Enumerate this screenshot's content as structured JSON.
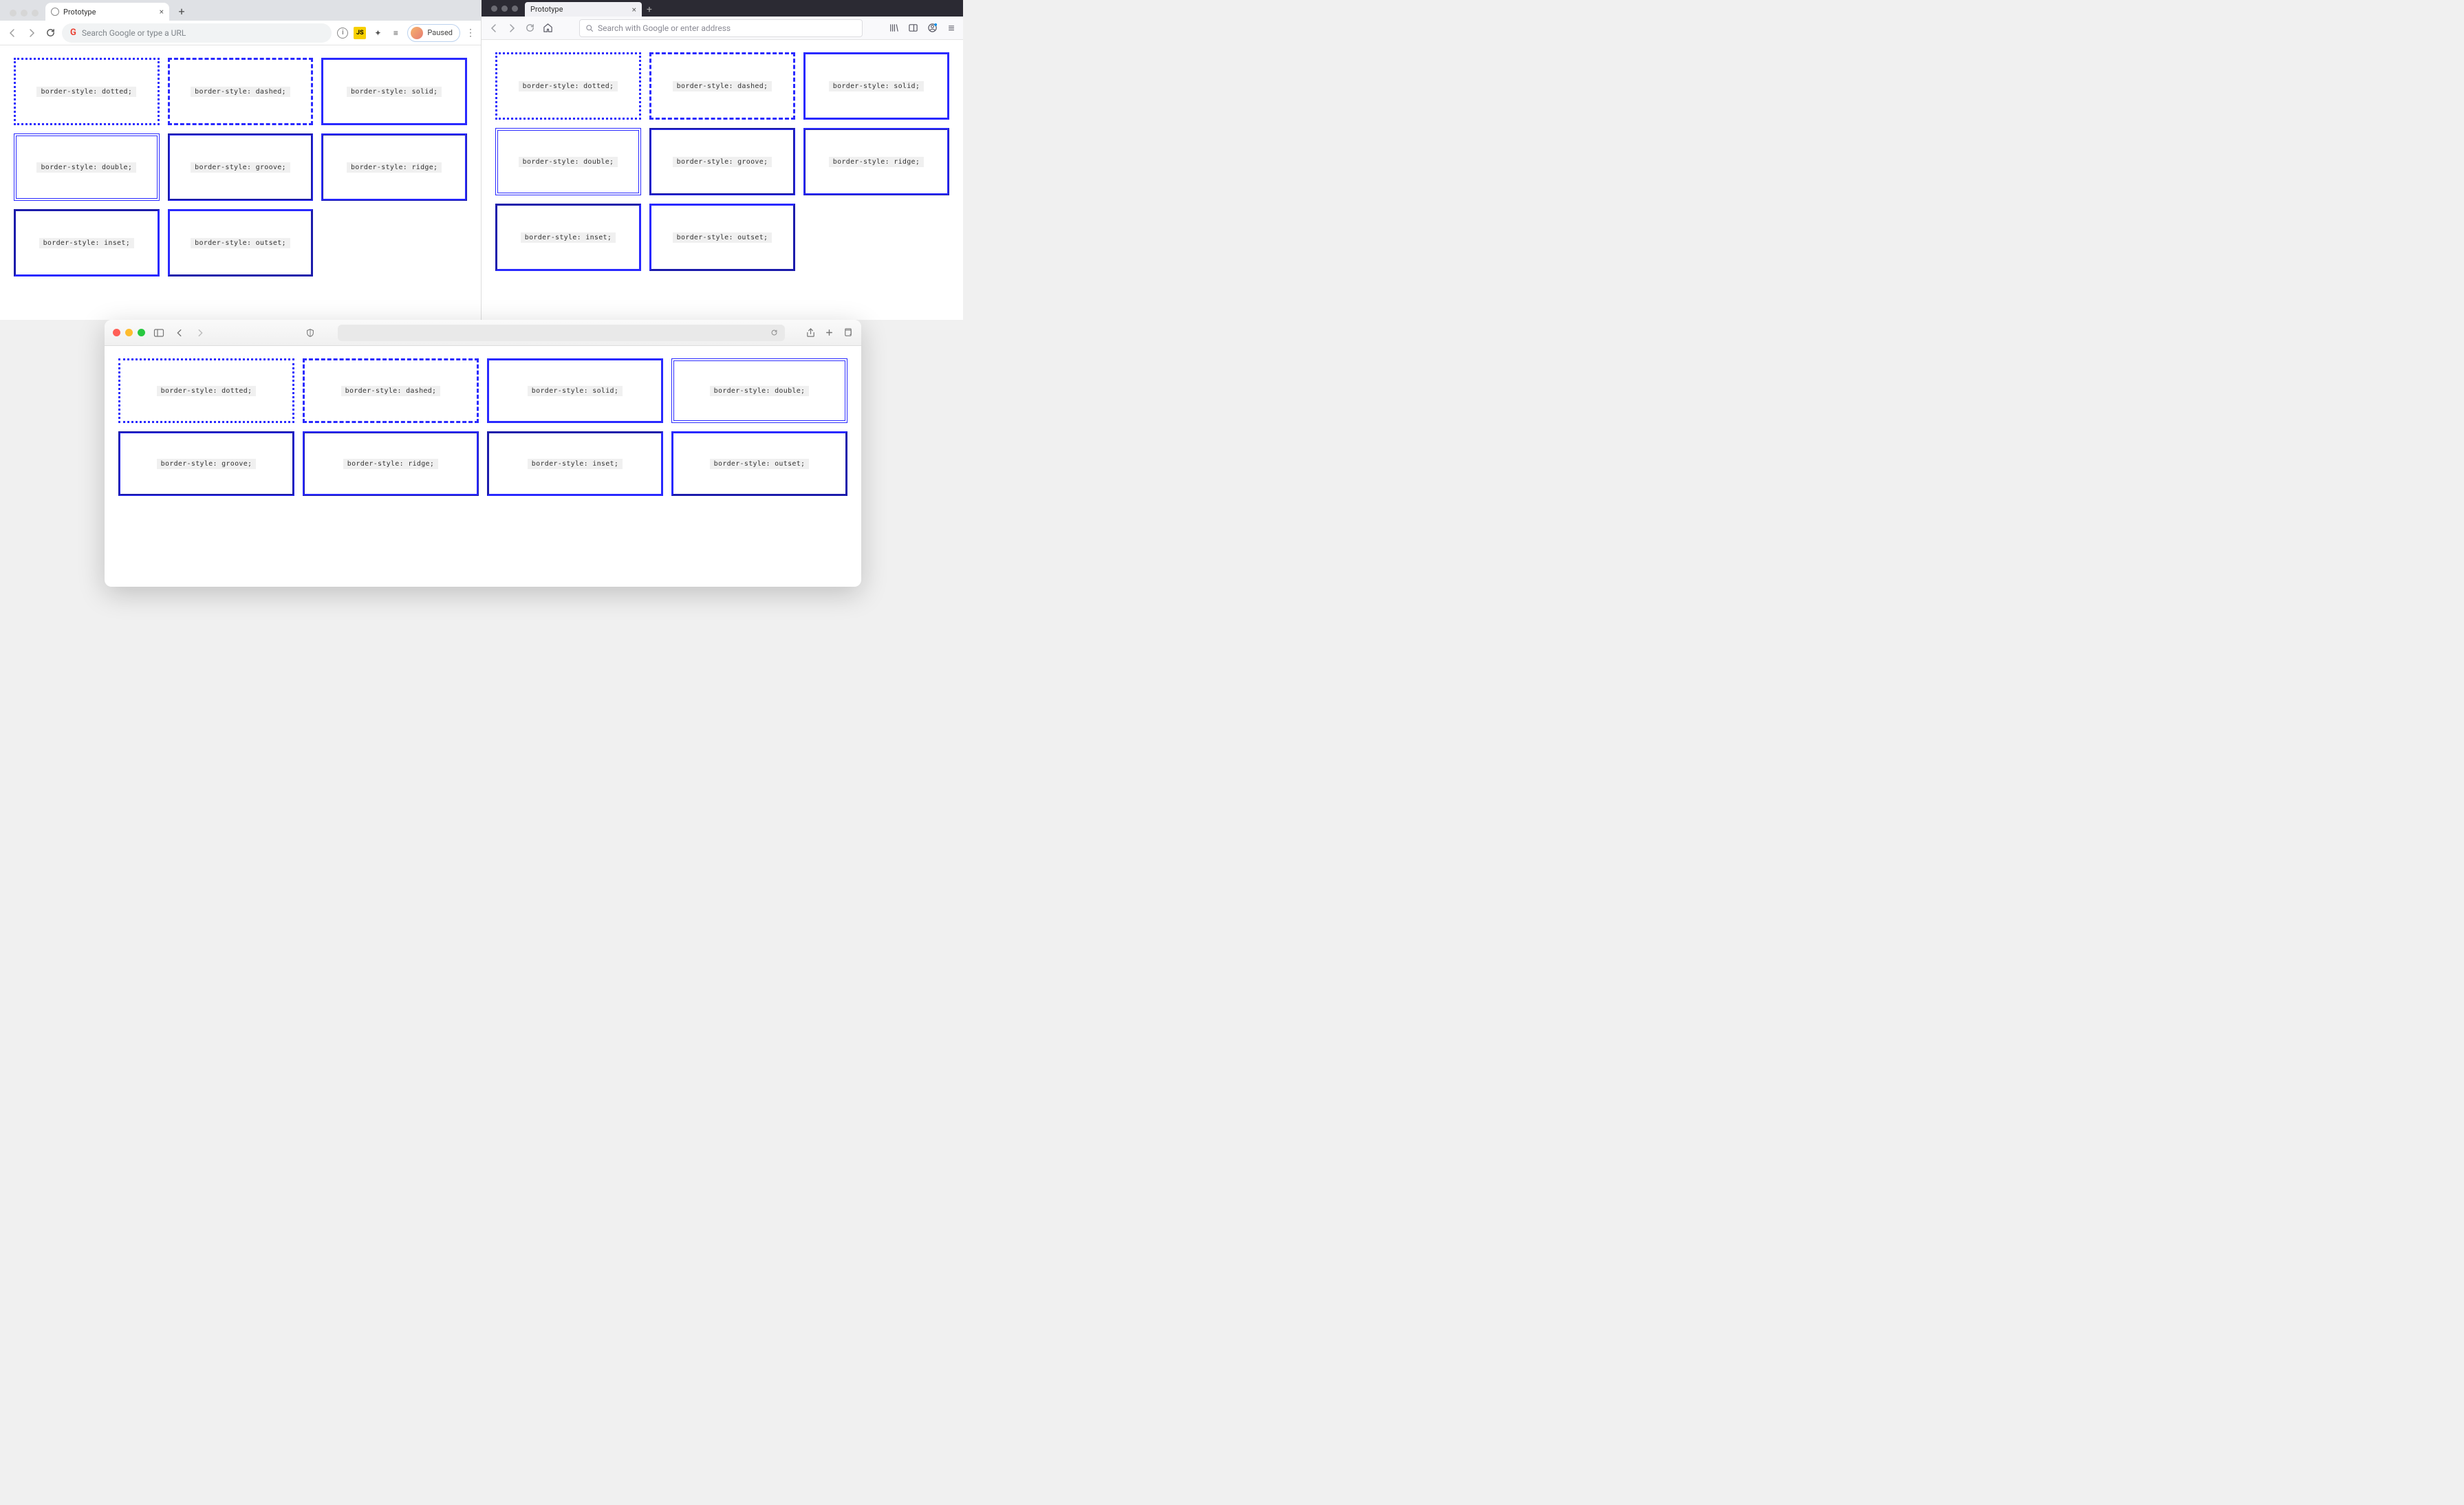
{
  "chrome": {
    "tab_title": "Prototype",
    "omnibox_placeholder": "Search Google or type a URL",
    "profile_label": "Paused",
    "content": {
      "boxes": [
        "border-style: dotted;",
        "border-style: dashed;",
        "border-style: solid;",
        "border-style: double;",
        "border-style: groove;",
        "border-style: ridge;",
        "border-style: inset;",
        "border-style: outset;"
      ]
    }
  },
  "firefox": {
    "tab_title": "Prototype",
    "urlbar_placeholder": "Search with Google or enter address",
    "content": {
      "boxes": [
        "border-style: dotted;",
        "border-style: dashed;",
        "border-style: solid;",
        "border-style: double;",
        "border-style: groove;",
        "border-style: ridge;",
        "border-style: inset;",
        "border-style: outset;"
      ]
    }
  },
  "safari": {
    "content": {
      "boxes": [
        "border-style: dotted;",
        "border-style: dashed;",
        "border-style: solid;",
        "border-style: double;",
        "border-style: groove;",
        "border-style: ridge;",
        "border-style: inset;",
        "border-style: outset;"
      ]
    }
  }
}
